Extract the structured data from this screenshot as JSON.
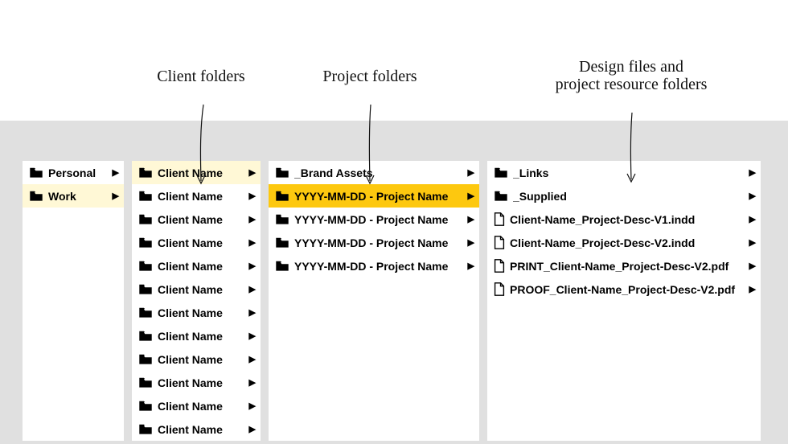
{
  "annotations": {
    "clients": "Client folders",
    "projects": "Project folders",
    "files": "Design files and\nproject resource folders"
  },
  "column1": [
    {
      "label": "Personal",
      "icon": "folder",
      "chevron": true,
      "selected": false
    },
    {
      "label": "Work",
      "icon": "folder",
      "chevron": true,
      "selected": true
    }
  ],
  "column2": [
    {
      "label": "Client Name",
      "icon": "folder",
      "chevron": true,
      "selected": true
    },
    {
      "label": "Client Name",
      "icon": "folder",
      "chevron": true,
      "selected": false
    },
    {
      "label": "Client Name",
      "icon": "folder",
      "chevron": true,
      "selected": false
    },
    {
      "label": "Client Name",
      "icon": "folder",
      "chevron": true,
      "selected": false
    },
    {
      "label": "Client Name",
      "icon": "folder",
      "chevron": true,
      "selected": false
    },
    {
      "label": "Client Name",
      "icon": "folder",
      "chevron": true,
      "selected": false
    },
    {
      "label": "Client Name",
      "icon": "folder",
      "chevron": true,
      "selected": false
    },
    {
      "label": "Client Name",
      "icon": "folder",
      "chevron": true,
      "selected": false
    },
    {
      "label": "Client Name",
      "icon": "folder",
      "chevron": true,
      "selected": false
    },
    {
      "label": "Client Name",
      "icon": "folder",
      "chevron": true,
      "selected": false
    },
    {
      "label": "Client Name",
      "icon": "folder",
      "chevron": true,
      "selected": false
    },
    {
      "label": "Client Name",
      "icon": "folder",
      "chevron": true,
      "selected": false
    }
  ],
  "column3": [
    {
      "label": "_Brand Assets",
      "icon": "folder",
      "chevron": true,
      "selected": false
    },
    {
      "label": "YYYY-MM-DD - Project Name",
      "icon": "folder",
      "chevron": true,
      "selected": true
    },
    {
      "label": "YYYY-MM-DD - Project Name",
      "icon": "folder",
      "chevron": true,
      "selected": false
    },
    {
      "label": "YYYY-MM-DD - Project Name",
      "icon": "folder",
      "chevron": true,
      "selected": false
    },
    {
      "label": "YYYY-MM-DD - Project Name",
      "icon": "folder",
      "chevron": true,
      "selected": false
    }
  ],
  "column4": [
    {
      "label": "_Links",
      "icon": "folder",
      "chevron": true
    },
    {
      "label": "_Supplied",
      "icon": "folder",
      "chevron": true
    },
    {
      "label": "Client-Name_Project-Desc-V1.indd",
      "icon": "file",
      "chevron": true
    },
    {
      "label": "Client-Name_Project-Desc-V2.indd",
      "icon": "file",
      "chevron": true
    },
    {
      "label": "PRINT_Client-Name_Project-Desc-V2.pdf",
      "icon": "file",
      "chevron": true
    },
    {
      "label": "PROOF_Client-Name_Project-Desc-V2.pdf",
      "icon": "file",
      "chevron": true
    }
  ]
}
